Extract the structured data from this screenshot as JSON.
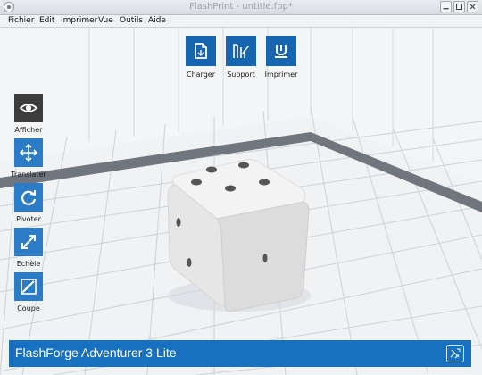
{
  "window": {
    "title": "FlashPrint - untitle.fpp*"
  },
  "menu": [
    "Fichier",
    "Edit",
    "Imprimer",
    "Vue",
    "Outils",
    "Aide"
  ],
  "top_toolbar": [
    {
      "label": "Charger",
      "icon": "file-load-icon"
    },
    {
      "label": "Support",
      "icon": "support-icon"
    },
    {
      "label": "Imprimer",
      "icon": "print-icon"
    }
  ],
  "left_toolbar": [
    {
      "label": "Afficher",
      "icon": "eye-icon"
    },
    {
      "label": "Translater",
      "icon": "move-arrows-icon"
    },
    {
      "label": "Pivoter",
      "icon": "rotate-icon"
    },
    {
      "label": "Echèle",
      "icon": "scale-icon"
    },
    {
      "label": "Coupe",
      "icon": "cut-icon"
    }
  ],
  "status": {
    "machine": "FlashForge Adventurer 3 Lite",
    "icon": "connect-icon"
  },
  "colors": {
    "accent": "#1565b0",
    "status_bar": "#1770c0",
    "active_tool": "#3d3d3d"
  }
}
